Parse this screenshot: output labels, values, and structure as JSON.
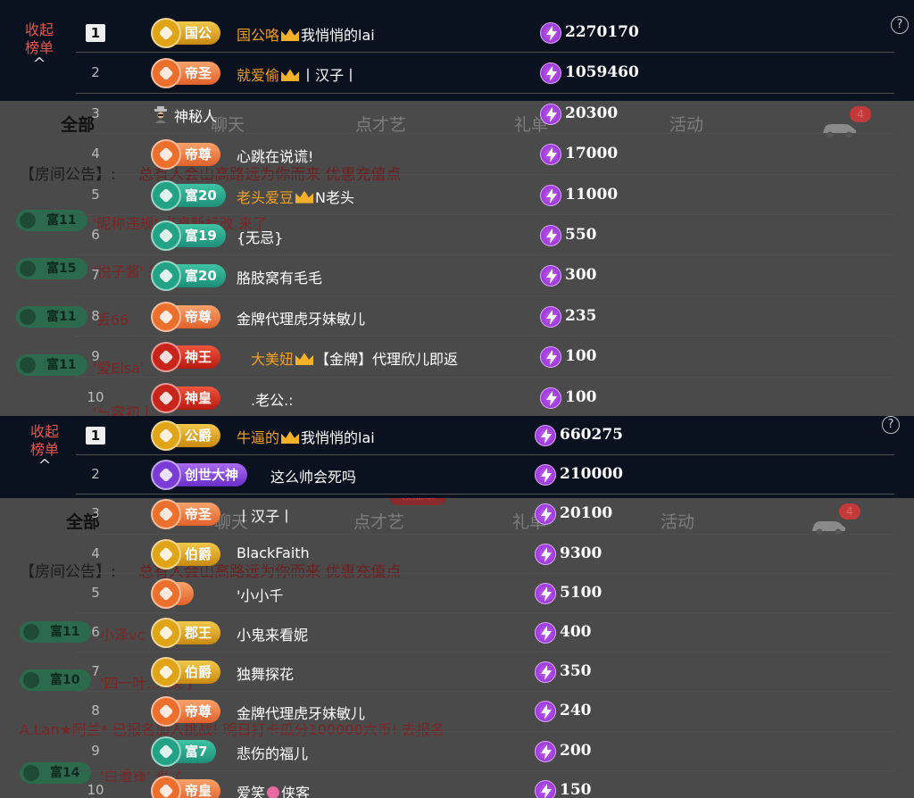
{
  "panel1": {
    "collapse_label": "收起榜单",
    "chevron": "^",
    "help": "?",
    "room_tabs": [
      "全部",
      "聊天",
      "点才艺",
      "礼单",
      "活动"
    ],
    "car_badge": "4",
    "announcement_label": "【房间公告】:",
    "announcement_text": "总有人会山高路远为你而来 优惠充值点",
    "chat_lines": [
      {
        "badge": "富11",
        "text": "'昵称违规' 点亮新标改 来了"
      },
      {
        "badge": "富15",
        "text": "'悦子酱' 来了"
      },
      {
        "badge": "富11",
        "text": "丢66"
      },
      {
        "badge": "富11",
        "text": "'爱Elsa'"
      },
      {
        "badge": "",
        "text": "'ㄣ容初丨...'"
      }
    ],
    "rows": [
      {
        "rank": "1",
        "level": "国公",
        "level_color": "gold",
        "name_orange": "国公咯",
        "crown": true,
        "name": "我悄悄的lai",
        "score": "2270170"
      },
      {
        "rank": "2",
        "level": "帝圣",
        "level_color": "orange",
        "name_orange": "就爱偷",
        "crown": true,
        "name": "丨汉子丨",
        "score": "1059460"
      },
      {
        "rank": "3",
        "level": "",
        "level_color": "",
        "name_orange": "",
        "crown": false,
        "name": "神秘人",
        "score": "20300"
      },
      {
        "rank": "4",
        "level": "帝尊",
        "level_color": "orange",
        "name_orange": "",
        "crown": false,
        "name": "心跳在说谎!",
        "score": "17000"
      },
      {
        "rank": "5",
        "level": "富20",
        "level_color": "green",
        "name_orange": "老头爱豆",
        "crown": true,
        "name": "N老头",
        "score": "11000"
      },
      {
        "rank": "6",
        "level": "富19",
        "level_color": "green",
        "name_orange": "",
        "crown": false,
        "name": "{无忌}",
        "score": "550"
      },
      {
        "rank": "7",
        "level": "富20",
        "level_color": "green",
        "name_orange": "",
        "crown": false,
        "name": "胳肢窝有毛毛",
        "score": "300"
      },
      {
        "rank": "8",
        "level": "帝尊",
        "level_color": "orange",
        "name_orange": "",
        "crown": false,
        "name": "金牌代理虎牙妹敏儿",
        "score": "235"
      },
      {
        "rank": "9",
        "level": "神王",
        "level_color": "red",
        "name_orange": "大美妞",
        "crown": true,
        "name": "【金牌】代理欣儿即返",
        "score": "100"
      },
      {
        "rank": "10",
        "level": "神皇",
        "level_color": "red",
        "name_orange": "",
        "crown": false,
        "name": ".老公.:",
        "score": "100"
      }
    ]
  },
  "panel2": {
    "collapse_label": "收起榜单",
    "chevron": "^",
    "help": "?",
    "room_tabs": [
      "全部",
      "聊天",
      "点才艺",
      "礼单",
      "活动"
    ],
    "chat_badge_tab": "领徽章",
    "car_badge": "4",
    "announcement_label": "【房间公告】:",
    "announcement_text": "总有人会山高路远为你而来 优惠充值点",
    "chat_lines": [
      {
        "badge": "富11",
        "text": "小泽vc"
      },
      {
        "badge": "富10",
        "text": "'四一叶...' 来了"
      },
      {
        "badge": "",
        "text": "A.Lan★阿兰* 已报名加入挑战! 明日打卡瓜分100000六币! 去报名"
      },
      {
        "badge": "富14",
        "text": "'白遭锋' 来了"
      }
    ],
    "rows": [
      {
        "rank": "1",
        "level": "公爵",
        "level_color": "gold",
        "name_orange": "牛逼的",
        "crown": true,
        "name": "我悄悄的lai",
        "score": "660275"
      },
      {
        "rank": "2",
        "level": "创世大神",
        "level_color": "purple",
        "name_orange": "",
        "crown": false,
        "name": "这么帅会死吗",
        "score": "210000"
      },
      {
        "rank": "3",
        "level": "帝圣",
        "level_color": "orange",
        "name_orange": "",
        "crown": false,
        "name": "丨汉子丨",
        "score": "20100"
      },
      {
        "rank": "4",
        "level": "伯爵",
        "level_color": "gold",
        "name_orange": "",
        "crown": false,
        "name": "BlackFaith",
        "score": "9300"
      },
      {
        "rank": "5",
        "level": "",
        "level_color": "orange",
        "name_orange": "",
        "crown": false,
        "name": "'小小千",
        "score": "5100"
      },
      {
        "rank": "6",
        "level": "郡王",
        "level_color": "gold",
        "name_orange": "",
        "crown": false,
        "name": "小鬼来看妮",
        "score": "400"
      },
      {
        "rank": "7",
        "level": "伯爵",
        "level_color": "gold",
        "name_orange": "",
        "crown": false,
        "name": "独舞探花",
        "score": "350"
      },
      {
        "rank": "8",
        "level": "帝尊",
        "level_color": "orange",
        "name_orange": "",
        "crown": false,
        "name": "金牌代理虎牙妹敏儿",
        "score": "240"
      },
      {
        "rank": "9",
        "level": "富7",
        "level_color": "green",
        "name_orange": "",
        "crown": false,
        "name": "悲伤的福儿",
        "score": "200"
      },
      {
        "rank": "10",
        "level": "帝皇",
        "level_color": "orange",
        "name_orange": "",
        "crown": false,
        "name": "爱笑",
        "flower": true,
        "name_after": "侠客",
        "score": "150"
      }
    ]
  }
}
